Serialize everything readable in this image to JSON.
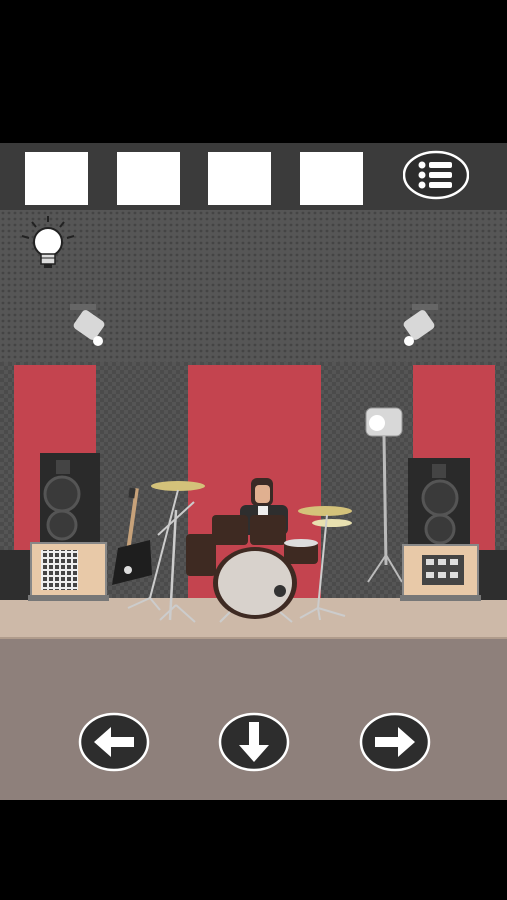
{
  "inventory": {
    "slots": [
      "",
      "",
      "",
      ""
    ]
  },
  "buttons": {
    "menu_icon": "menu-list-icon",
    "hint_icon": "lightbulb-icon",
    "left_icon": "arrow-left-icon",
    "back_icon": "arrow-down-icon",
    "right_icon": "arrow-right-icon"
  },
  "scene": {
    "name": "recording-studio",
    "objects": [
      "ceiling-spotlight-left",
      "ceiling-spotlight-right",
      "red-wall-panels",
      "speaker-left",
      "speaker-right",
      "amplifier-left",
      "amplifier-right",
      "electric-guitar",
      "microphone-stand",
      "drum-kit",
      "drummer",
      "studio-light-stand"
    ]
  },
  "colors": {
    "topbar": "#3b3b3b",
    "wall_red": "#c4444f",
    "wall_gray": "#5b5b5b",
    "floor": "#8e807b",
    "stage": "#cdb9a8"
  }
}
